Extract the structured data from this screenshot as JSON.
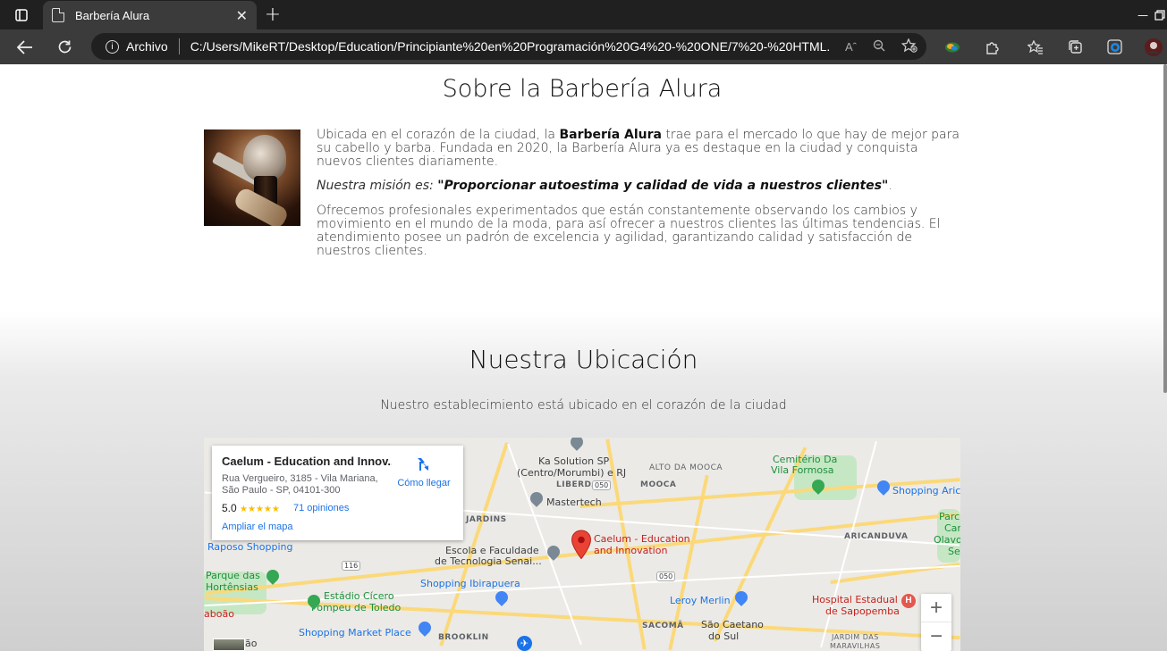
{
  "browser": {
    "tab_title": "Barbería Alura",
    "tab_close": "✕",
    "new_tab": "+",
    "address_label": "Archivo",
    "url": "C:/Users/MikeRT/Desktop/Education/Principiante%20en%20Programación%20G4%20-%20ONE/7%20-%20HTML...",
    "read_aloud": "Aˆ",
    "icons": [
      "sidebar-icon",
      "back-icon",
      "refresh-icon",
      "info-icon",
      "zoom-icon",
      "favorite-add-icon",
      "collections-icon",
      "extensions-icon",
      "favorites-icon",
      "tabs-icon",
      "edge-icon",
      "profile-icon",
      "minimize-icon",
      "restore-icon"
    ]
  },
  "about": {
    "title": "Sobre la Barbería Alura",
    "p1_pre": "Ubicada en el corazón de la ciudad, la ",
    "p1_bold": "Barbería Alura",
    "p1_post": " trae para el mercado lo que hay de mejor para su cabello y barba. Fundada en 2020, la Barbería Alura ya es destaque en la ciudad y conquista nuevos clientes diariamente.",
    "p2_italic": "Nuestra misión es: ",
    "p2_bold": "\"Proporcionar autoestima y calidad de vida a nuestros clientes\"",
    "p2_end": ".",
    "p3": "Ofrecemos profesionales experimentados que están constantemente observando los cambios y movimiento en el mundo de la moda, para así ofrecer a nuestros clientes las últimas tendencias. El atendimiento posee un padrón de excelencia y agilidad, garantizando calidad y satisfacción de nuestros clientes."
  },
  "location": {
    "title": "Nuestra Ubicación",
    "subtitle": "Nuestro establecimiento está ubicado en el corazón de la ciudad"
  },
  "map": {
    "card_title": "Caelum - Education and Innov...",
    "card_address": "Rua Vergueiro, 3185 - Vila Mariana, São Paulo - SP, 04101-300",
    "rating": "5.0",
    "stars": "★★★★★",
    "reviews": "71 opiniones",
    "directions": "Cómo llegar",
    "enlarge": "Ampliar el mapa",
    "zoom_in": "+",
    "zoom_out": "−",
    "marker_label_1": "Caelum - Education",
    "marker_label_2": "and Innovation",
    "labels": {
      "ka_solution_1": "Ka Solution SP",
      "ka_solution_2": "(Centro/Morumbi) e RJ",
      "alto_mooca": "ALTO DA MOOCA",
      "cemiterio_1": "Cemitério Da",
      "cemiterio_2": "Vila Formosa",
      "liberdade": "LIBERDADE",
      "mooca": "MOOCA",
      "shopping_aric": "Shopping Aric",
      "mastertech": "Mastertech",
      "jardins": "JARDINS",
      "parq_1": "Parc",
      "parq_2": "Car",
      "parq_3": "Olavo",
      "parq_4": "Se",
      "raposo": "Raposo Shopping",
      "escola_1": "Escola e Faculdade",
      "escola_2": "de Tecnologia Senai...",
      "aricanduva": "ARICANDUVA",
      "parque_aguas_1": "Parque das",
      "parque_aguas_2": "Hortênsias",
      "shopping_ibira": "Shopping Ibirapuera",
      "estadio_1": "Estádio Cícero",
      "estadio_2": "Pompeu de Toledo",
      "leroy": "Leroy Merlin",
      "hospital_1": "Hospital Estadual",
      "hospital_2": "de Sapopemba",
      "taboao": "aboão",
      "sacoma": "SACOMÃ",
      "sao_caetano_1": "São Caetano",
      "sao_caetano_2": "do Sul",
      "shopping_market": "Shopping Market Place",
      "brooklin": "BROOKLIN",
      "jardim_1": "JARDIM DAS",
      "jardim_2": "MARAVILHAS",
      "sao": "ão",
      "road_116": "116",
      "road_050a": "050",
      "road_050b": "050"
    }
  }
}
